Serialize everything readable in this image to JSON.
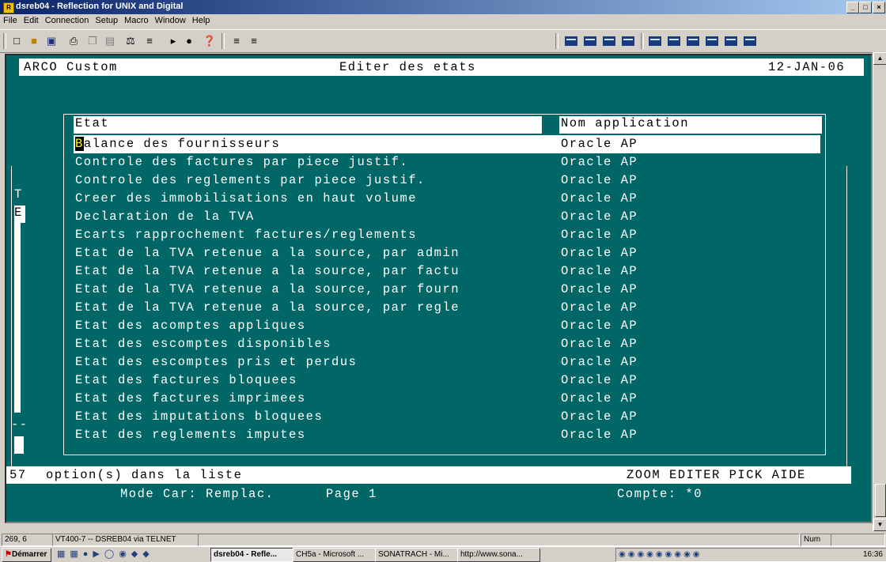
{
  "window": {
    "title": "dsreb04 - Reflection for UNIX and Digital"
  },
  "menu": [
    "File",
    "Edit",
    "Connection",
    "Setup",
    "Macro",
    "Window",
    "Help"
  ],
  "terminal": {
    "header_left": "ARCO Custom",
    "header_center": "Editer des etats",
    "header_right": "12-JAN-06",
    "col_state": "Etat",
    "col_app": "Nom application",
    "rows": [
      {
        "state": "Balance des fournisseurs",
        "app": "Oracle AP"
      },
      {
        "state": "Controle des factures par piece justif.",
        "app": "Oracle AP"
      },
      {
        "state": "Controle des reglements par piece justif.",
        "app": "Oracle AP"
      },
      {
        "state": "Creer des immobilisations en haut volume",
        "app": "Oracle AP"
      },
      {
        "state": "Declaration de la TVA",
        "app": "Oracle AP"
      },
      {
        "state": "Ecarts rapprochement factures/reglements",
        "app": "Oracle AP"
      },
      {
        "state": "Etat de la TVA retenue a la source, par admin",
        "app": "Oracle AP"
      },
      {
        "state": "Etat de la TVA retenue a la source, par factu",
        "app": "Oracle AP"
      },
      {
        "state": "Etat de la TVA retenue a la source, par fourn",
        "app": "Oracle AP"
      },
      {
        "state": "Etat de la TVA retenue a la source, par regle",
        "app": "Oracle AP"
      },
      {
        "state": "Etat des acomptes appliques",
        "app": "Oracle AP"
      },
      {
        "state": "Etat des escomptes disponibles",
        "app": "Oracle AP"
      },
      {
        "state": "Etat des escomptes pris et perdus",
        "app": "Oracle AP"
      },
      {
        "state": "Etat des factures bloquees",
        "app": "Oracle AP"
      },
      {
        "state": "Etat des factures imprimees",
        "app": "Oracle AP"
      },
      {
        "state": "Etat des imputations bloquees",
        "app": "Oracle AP"
      },
      {
        "state": "Etat des reglements imputes",
        "app": "Oracle AP"
      }
    ],
    "left_letters": [
      "T",
      "E"
    ],
    "left_dash": "--",
    "option_count": "57",
    "option_text": "option(s) dans la liste",
    "actions": "ZOOM EDITER PICK AIDE",
    "mode": "Mode Car: Remplac.",
    "page": "Page 1",
    "compte": "Compte: *0"
  },
  "status": {
    "cursor": "269, 6",
    "session": "VT400-7 -- DSREB04 via TELNET",
    "num": "Num"
  },
  "taskbar": {
    "start": "Démarrer",
    "tasks": [
      "dsreb04 - Refle...",
      "CH5a - Microsoft ...",
      "SONATRACH - Mi...",
      "http://www.sona..."
    ],
    "clock": "16:36"
  }
}
